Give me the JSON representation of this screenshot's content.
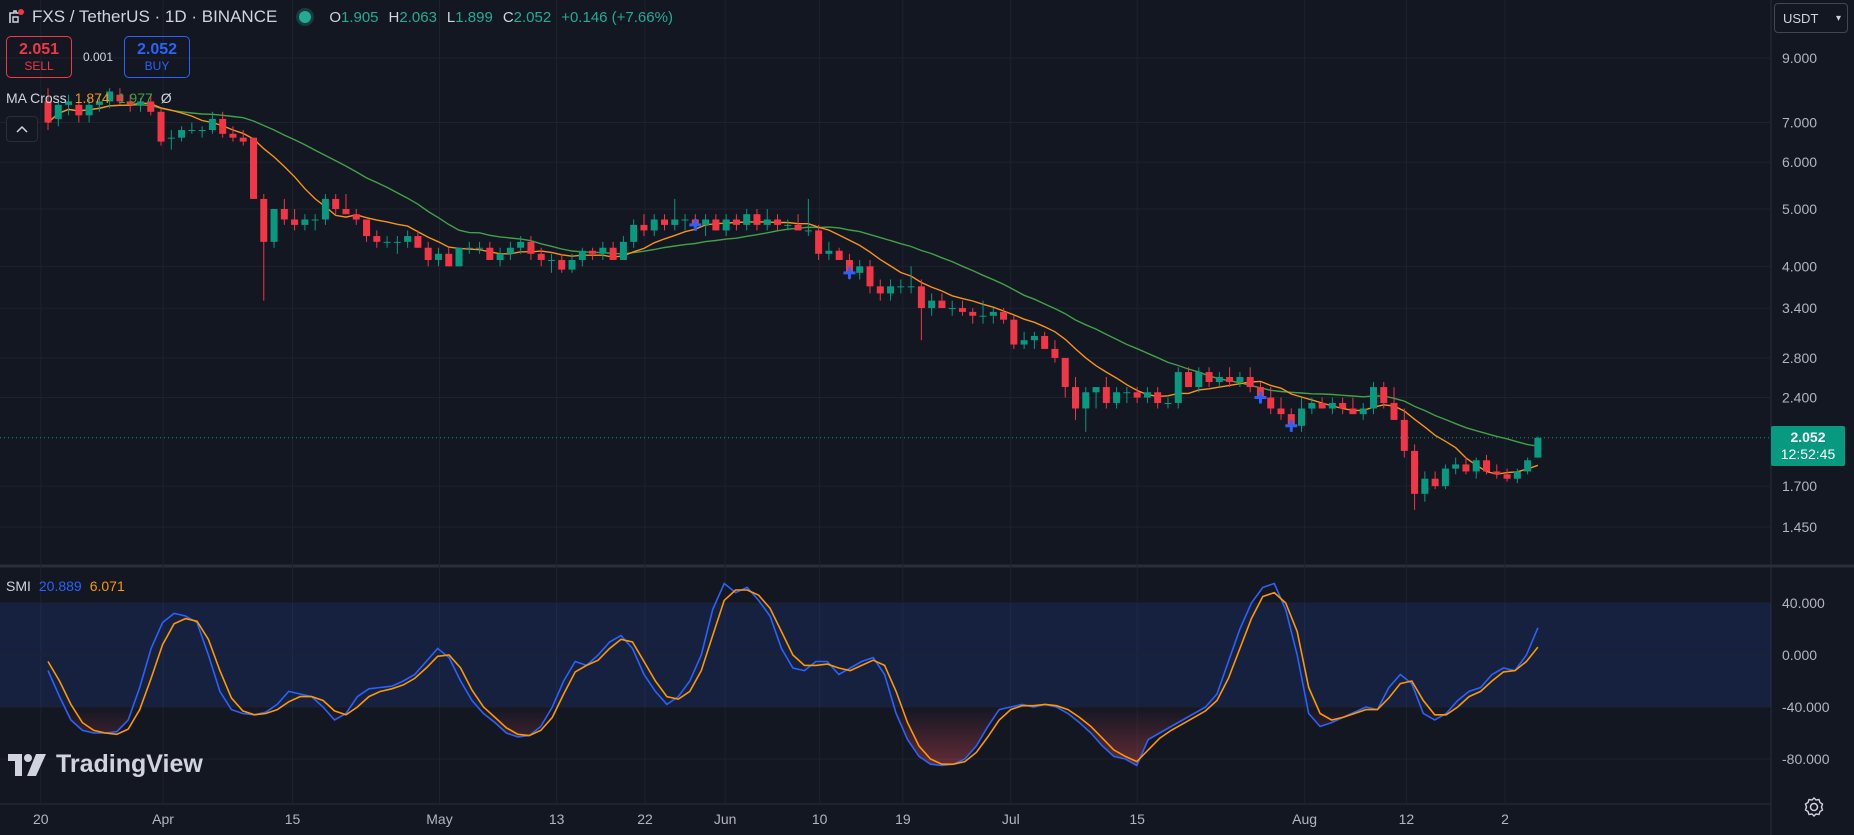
{
  "header": {
    "symbol": "FXS / TetherUS · 1D · BINANCE",
    "o_label": "O",
    "o": "1.905",
    "h_label": "H",
    "h": "2.063",
    "l_label": "L",
    "l": "1.899",
    "c_label": "C",
    "c": "2.052",
    "change": "+0.146 (+7.66%)"
  },
  "trade": {
    "sell_price": "2.051",
    "sell_label": "SELL",
    "spread": "0.001",
    "buy_price": "2.052",
    "buy_label": "BUY"
  },
  "ma_legend": {
    "name": "MA Cross",
    "fast": "1.874",
    "slow": "1.977",
    "extra": "Ø"
  },
  "smi_legend": {
    "name": "SMI",
    "smi": "20.889",
    "signal": "6.071"
  },
  "currency": {
    "label": "USDT"
  },
  "price_tag": {
    "price": "2.052",
    "countdown": "12:52:45"
  },
  "logo": {
    "text": "TradingView"
  },
  "colors": {
    "up": "#089981",
    "down": "#f23645",
    "ma_fast": "#f7931a",
    "ma_slow": "#43a047",
    "smi": "#2962ff",
    "signal": "#ff9800",
    "background": "#131722"
  },
  "chart_data": [
    {
      "type": "candlestick",
      "y_scale": "log",
      "ylim": [
        1.3,
        10.2
      ],
      "y_ticks": [
        "9.000",
        "7.000",
        "6.000",
        "5.000",
        "4.000",
        "3.400",
        "2.800",
        "2.400",
        "1.700",
        "1.450"
      ],
      "x_ticks": [
        "20",
        "Apr",
        "15",
        "May",
        "13",
        "22",
        "Jun",
        "10",
        "19",
        "Jul",
        "15",
        "Aug",
        "12",
        "2"
      ],
      "candles_ohlc": [
        [
          7.6,
          8.0,
          6.8,
          7.0
        ],
        [
          7.1,
          7.6,
          6.9,
          7.5
        ],
        [
          7.5,
          7.8,
          7.2,
          7.6
        ],
        [
          7.5,
          7.6,
          7.0,
          7.2
        ],
        [
          7.2,
          7.7,
          7.0,
          7.5
        ],
        [
          7.5,
          7.8,
          7.3,
          7.6
        ],
        [
          7.6,
          8.0,
          7.4,
          7.9
        ],
        [
          7.8,
          8.0,
          7.5,
          7.6
        ],
        [
          7.6,
          7.8,
          7.3,
          7.5
        ],
        [
          7.5,
          7.7,
          7.3,
          7.6
        ],
        [
          7.6,
          7.8,
          7.2,
          7.3
        ],
        [
          7.3,
          7.4,
          6.4,
          6.5
        ],
        [
          6.6,
          6.8,
          6.3,
          6.6
        ],
        [
          6.6,
          6.9,
          6.5,
          6.8
        ],
        [
          6.8,
          7.0,
          6.7,
          6.8
        ],
        [
          6.8,
          6.9,
          6.6,
          6.8
        ],
        [
          6.8,
          7.3,
          6.7,
          7.1
        ],
        [
          7.1,
          7.3,
          6.6,
          6.7
        ],
        [
          6.7,
          6.9,
          6.5,
          6.6
        ],
        [
          6.6,
          6.8,
          6.4,
          6.5
        ],
        [
          6.6,
          6.6,
          5.2,
          5.2
        ],
        [
          5.2,
          5.3,
          3.5,
          4.4
        ],
        [
          4.4,
          5.0,
          4.3,
          5.0
        ],
        [
          5.0,
          5.2,
          4.7,
          4.8
        ],
        [
          4.8,
          5.0,
          4.6,
          4.7
        ],
        [
          4.7,
          4.9,
          4.6,
          4.8
        ],
        [
          4.8,
          4.9,
          4.6,
          4.8
        ],
        [
          4.8,
          5.3,
          4.7,
          5.2
        ],
        [
          5.2,
          5.3,
          4.9,
          5.0
        ],
        [
          5.0,
          5.3,
          4.9,
          4.9
        ],
        [
          4.9,
          5.0,
          4.7,
          4.8
        ],
        [
          4.8,
          4.8,
          4.4,
          4.5
        ],
        [
          4.5,
          4.6,
          4.3,
          4.4
        ],
        [
          4.4,
          4.5,
          4.3,
          4.4
        ],
        [
          4.4,
          4.5,
          4.2,
          4.4
        ],
        [
          4.4,
          4.6,
          4.3,
          4.5
        ],
        [
          4.5,
          4.6,
          4.3,
          4.3
        ],
        [
          4.3,
          4.4,
          4.0,
          4.1
        ],
        [
          4.1,
          4.3,
          4.0,
          4.2
        ],
        [
          4.2,
          4.3,
          4.0,
          4.0
        ],
        [
          4.0,
          4.3,
          4.0,
          4.3
        ],
        [
          4.3,
          4.4,
          4.2,
          4.3
        ],
        [
          4.3,
          4.4,
          4.2,
          4.3
        ],
        [
          4.3,
          4.4,
          4.1,
          4.1
        ],
        [
          4.1,
          4.3,
          4.0,
          4.2
        ],
        [
          4.2,
          4.4,
          4.1,
          4.3
        ],
        [
          4.3,
          4.5,
          4.2,
          4.4
        ],
        [
          4.4,
          4.5,
          4.1,
          4.2
        ],
        [
          4.2,
          4.3,
          4.0,
          4.1
        ],
        [
          4.1,
          4.2,
          3.9,
          4.1
        ],
        [
          4.1,
          4.2,
          3.9,
          3.95
        ],
        [
          3.95,
          4.2,
          3.9,
          4.1
        ],
        [
          4.1,
          4.3,
          4.0,
          4.25
        ],
        [
          4.25,
          4.3,
          4.1,
          4.2
        ],
        [
          4.2,
          4.4,
          4.1,
          4.3
        ],
        [
          4.3,
          4.4,
          4.1,
          4.1
        ],
        [
          4.1,
          4.5,
          4.1,
          4.4
        ],
        [
          4.4,
          4.8,
          4.3,
          4.7
        ],
        [
          4.7,
          4.9,
          4.5,
          4.6
        ],
        [
          4.6,
          4.9,
          4.5,
          4.8
        ],
        [
          4.8,
          4.9,
          4.6,
          4.7
        ],
        [
          4.7,
          5.2,
          4.6,
          4.8
        ],
        [
          4.8,
          4.9,
          4.6,
          4.8
        ],
        [
          4.8,
          4.9,
          4.6,
          4.7
        ],
        [
          4.7,
          4.9,
          4.5,
          4.8
        ],
        [
          4.8,
          4.9,
          4.6,
          4.6
        ],
        [
          4.6,
          4.9,
          4.5,
          4.8
        ],
        [
          4.8,
          4.9,
          4.6,
          4.7
        ],
        [
          4.7,
          5.0,
          4.6,
          4.9
        ],
        [
          4.9,
          5.0,
          4.6,
          4.7
        ],
        [
          4.7,
          5.0,
          4.6,
          4.8
        ],
        [
          4.8,
          4.9,
          4.6,
          4.7
        ],
        [
          4.7,
          4.8,
          4.6,
          4.7
        ],
        [
          4.7,
          4.9,
          4.6,
          4.6
        ],
        [
          4.6,
          5.2,
          4.5,
          4.6
        ],
        [
          4.6,
          4.7,
          4.1,
          4.2
        ],
        [
          4.2,
          4.4,
          4.1,
          4.25
        ],
        [
          4.25,
          4.3,
          4.1,
          4.1
        ],
        [
          4.1,
          4.2,
          3.8,
          3.9
        ],
        [
          3.9,
          4.1,
          3.8,
          4.0
        ],
        [
          4.0,
          4.1,
          3.6,
          3.7
        ],
        [
          3.7,
          3.8,
          3.5,
          3.6
        ],
        [
          3.6,
          3.8,
          3.5,
          3.7
        ],
        [
          3.7,
          3.8,
          3.6,
          3.7
        ],
        [
          3.7,
          4.0,
          3.6,
          3.7
        ],
        [
          3.7,
          3.8,
          3.0,
          3.4
        ],
        [
          3.4,
          3.6,
          3.3,
          3.5
        ],
        [
          3.5,
          3.6,
          3.4,
          3.4
        ],
        [
          3.4,
          3.5,
          3.3,
          3.4
        ],
        [
          3.4,
          3.5,
          3.3,
          3.35
        ],
        [
          3.35,
          3.4,
          3.2,
          3.3
        ],
        [
          3.3,
          3.5,
          3.2,
          3.3
        ],
        [
          3.3,
          3.4,
          3.2,
          3.35
        ],
        [
          3.35,
          3.4,
          3.2,
          3.25
        ],
        [
          3.25,
          3.3,
          2.9,
          2.95
        ],
        [
          2.95,
          3.1,
          2.9,
          3.0
        ],
        [
          3.0,
          3.1,
          2.9,
          3.05
        ],
        [
          3.05,
          3.1,
          2.9,
          2.9
        ],
        [
          2.9,
          3.0,
          2.75,
          2.8
        ],
        [
          2.8,
          2.8,
          2.4,
          2.5
        ],
        [
          2.5,
          2.6,
          2.2,
          2.3
        ],
        [
          2.3,
          2.5,
          2.1,
          2.45
        ],
        [
          2.45,
          2.5,
          2.3,
          2.5
        ],
        [
          2.5,
          2.6,
          2.3,
          2.35
        ],
        [
          2.35,
          2.5,
          2.3,
          2.45
        ],
        [
          2.45,
          2.5,
          2.35,
          2.45
        ],
        [
          2.45,
          2.5,
          2.35,
          2.4
        ],
        [
          2.4,
          2.5,
          2.35,
          2.45
        ],
        [
          2.45,
          2.5,
          2.3,
          2.35
        ],
        [
          2.35,
          2.4,
          2.3,
          2.35
        ],
        [
          2.35,
          2.7,
          2.3,
          2.65
        ],
        [
          2.65,
          2.7,
          2.5,
          2.5
        ],
        [
          2.5,
          2.7,
          2.45,
          2.65
        ],
        [
          2.65,
          2.7,
          2.5,
          2.55
        ],
        [
          2.55,
          2.65,
          2.5,
          2.6
        ],
        [
          2.6,
          2.7,
          2.5,
          2.55
        ],
        [
          2.55,
          2.65,
          2.5,
          2.6
        ],
        [
          2.6,
          2.7,
          2.45,
          2.5
        ],
        [
          2.5,
          2.55,
          2.35,
          2.4
        ],
        [
          2.4,
          2.5,
          2.25,
          2.3
        ],
        [
          2.3,
          2.4,
          2.2,
          2.25
        ],
        [
          2.25,
          2.3,
          2.1,
          2.15
        ],
        [
          2.15,
          2.4,
          2.1,
          2.3
        ],
        [
          2.3,
          2.4,
          2.25,
          2.35
        ],
        [
          2.35,
          2.4,
          2.3,
          2.3
        ],
        [
          2.3,
          2.4,
          2.25,
          2.35
        ],
        [
          2.35,
          2.4,
          2.25,
          2.3
        ],
        [
          2.3,
          2.4,
          2.25,
          2.25
        ],
        [
          2.25,
          2.35,
          2.2,
          2.3
        ],
        [
          2.3,
          2.55,
          2.25,
          2.5
        ],
        [
          2.5,
          2.55,
          2.3,
          2.35
        ],
        [
          2.35,
          2.5,
          2.2,
          2.2
        ],
        [
          2.2,
          2.3,
          1.9,
          1.95
        ],
        [
          1.95,
          2.0,
          1.55,
          1.65
        ],
        [
          1.65,
          1.8,
          1.6,
          1.75
        ],
        [
          1.75,
          1.8,
          1.68,
          1.7
        ],
        [
          1.7,
          1.85,
          1.68,
          1.82
        ],
        [
          1.82,
          1.9,
          1.78,
          1.85
        ],
        [
          1.85,
          1.9,
          1.78,
          1.8
        ],
        [
          1.8,
          1.9,
          1.75,
          1.88
        ],
        [
          1.88,
          1.92,
          1.78,
          1.8
        ],
        [
          1.8,
          1.85,
          1.75,
          1.78
        ],
        [
          1.78,
          1.82,
          1.73,
          1.75
        ],
        [
          1.75,
          1.82,
          1.72,
          1.8
        ],
        [
          1.8,
          1.9,
          1.78,
          1.88
        ],
        [
          1.9,
          2.063,
          1.899,
          2.052
        ]
      ],
      "ma_fast": [
        1.874
      ],
      "ma_slow": [
        1.977
      ],
      "last_price": 2.052,
      "cross_markers_candle_index": [
        63,
        78,
        118,
        121
      ]
    },
    {
      "type": "line",
      "title": "SMI",
      "ylim": [
        -90,
        58
      ],
      "y_ticks": [
        "40.000",
        "0.000",
        "-40.000",
        "-80.000"
      ],
      "band": [
        -40,
        40
      ],
      "series": [
        {
          "name": "SMI",
          "values": [
            -12,
            -32,
            -50,
            -58,
            -60,
            -60,
            -59,
            -50,
            -25,
            5,
            25,
            32,
            30,
            25,
            0,
            -28,
            -42,
            -45,
            -46,
            -44,
            -38,
            -28,
            -30,
            -32,
            -40,
            -50,
            -45,
            -32,
            -26,
            -25,
            -24,
            -20,
            -15,
            -5,
            5,
            -2,
            -20,
            -35,
            -45,
            -52,
            -60,
            -63,
            -62,
            -55,
            -40,
            -20,
            -5,
            -8,
            0,
            10,
            15,
            5,
            -15,
            -28,
            -38,
            -32,
            -20,
            0,
            35,
            55,
            48,
            52,
            42,
            30,
            5,
            -10,
            -12,
            -5,
            -5,
            -15,
            -10,
            -5,
            -2,
            -15,
            -45,
            -65,
            -78,
            -84,
            -85,
            -84,
            -80,
            -70,
            -55,
            -42,
            -40,
            -38,
            -40,
            -38,
            -40,
            -45,
            -52,
            -60,
            -70,
            -78,
            -80,
            -85,
            -65,
            -60,
            -55,
            -50,
            -45,
            -40,
            -30,
            -5,
            20,
            40,
            52,
            55,
            35,
            0,
            -45,
            -55,
            -52,
            -48,
            -44,
            -40,
            -42,
            -25,
            -15,
            -22,
            -45,
            -50,
            -45,
            -35,
            -28,
            -25,
            -15,
            -10,
            -12,
            0,
            20.889
          ]
        },
        {
          "name": "Signal",
          "values": [
            -5,
            -20,
            -38,
            -52,
            -58,
            -60,
            -61,
            -57,
            -42,
            -18,
            8,
            24,
            28,
            26,
            12,
            -12,
            -33,
            -43,
            -46,
            -45,
            -42,
            -36,
            -32,
            -32,
            -35,
            -43,
            -46,
            -40,
            -32,
            -28,
            -26,
            -23,
            -18,
            -10,
            -1,
            0,
            -10,
            -27,
            -40,
            -48,
            -56,
            -61,
            -62,
            -58,
            -48,
            -30,
            -13,
            -8,
            -4,
            5,
            12,
            10,
            -5,
            -20,
            -32,
            -34,
            -28,
            -12,
            15,
            42,
            50,
            50,
            46,
            36,
            18,
            0,
            -8,
            -8,
            -7,
            -10,
            -12,
            -8,
            -4,
            -8,
            -28,
            -52,
            -70,
            -80,
            -84,
            -84,
            -82,
            -75,
            -63,
            -50,
            -42,
            -39,
            -39,
            -38,
            -39,
            -42,
            -48,
            -55,
            -64,
            -73,
            -78,
            -82,
            -73,
            -64,
            -58,
            -53,
            -48,
            -43,
            -35,
            -18,
            5,
            28,
            45,
            48,
            40,
            18,
            -25,
            -45,
            -50,
            -48,
            -45,
            -42,
            -42,
            -33,
            -22,
            -20,
            -35,
            -46,
            -46,
            -40,
            -32,
            -28,
            -20,
            -13,
            -12,
            -5,
            6.071
          ]
        }
      ]
    }
  ]
}
